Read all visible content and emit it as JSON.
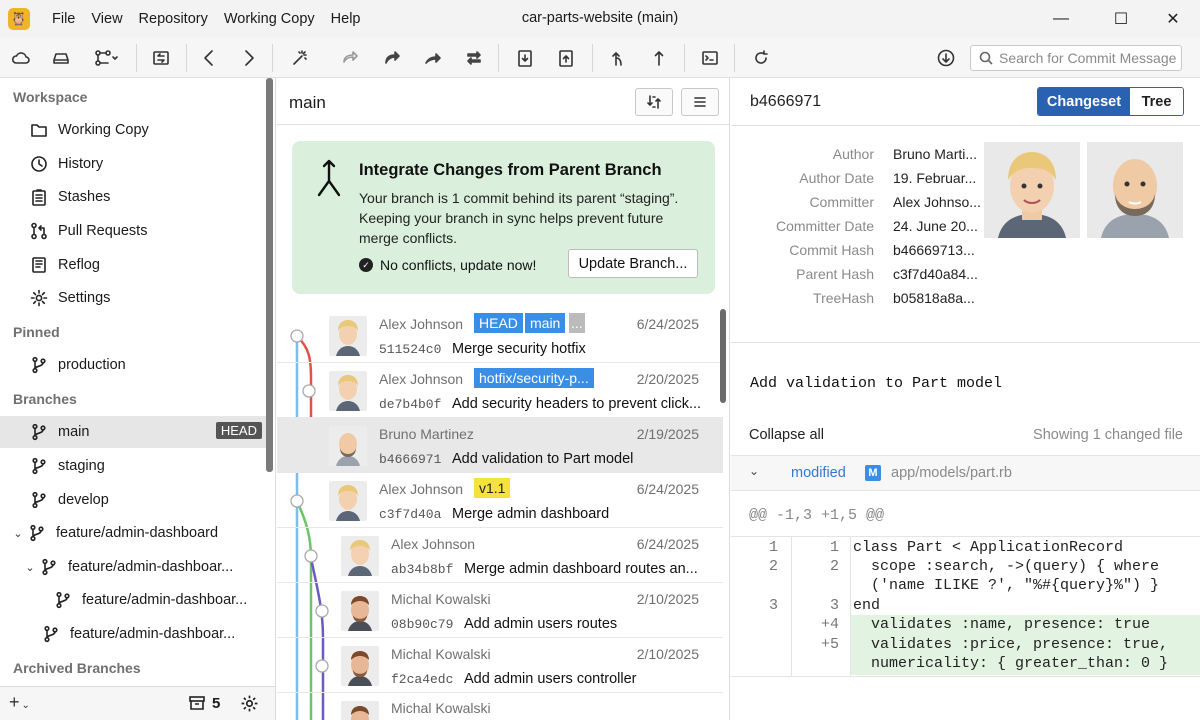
{
  "window": {
    "title": "car-parts-website (main)",
    "menu": [
      "File",
      "View",
      "Repository",
      "Working Copy",
      "Help"
    ]
  },
  "toolbar": {
    "search_placeholder": "Search for Commit Message"
  },
  "sidebar": {
    "workspace_title": "Workspace",
    "workspace_items": [
      {
        "label": "Working Copy",
        "icon": "folder-icon"
      },
      {
        "label": "History",
        "icon": "history-icon"
      },
      {
        "label": "Stashes",
        "icon": "clipboard-icon"
      },
      {
        "label": "Pull Requests",
        "icon": "pull-request-icon"
      },
      {
        "label": "Reflog",
        "icon": "book-icon"
      },
      {
        "label": "Settings",
        "icon": "gear-icon"
      }
    ],
    "pinned_title": "Pinned",
    "pinned_items": [
      {
        "label": "production"
      }
    ],
    "branches_title": "Branches",
    "branches": [
      {
        "label": "main",
        "badge": "HEAD",
        "selected": true
      },
      {
        "label": "staging"
      },
      {
        "label": "develop"
      },
      {
        "label": "feature/admin-dashboard"
      },
      {
        "label": "feature/admin-dashboar..."
      },
      {
        "label": "feature/admin-dashboar..."
      },
      {
        "label": "feature/admin-dashboar..."
      }
    ],
    "archived_title": "Archived Branches",
    "footer": {
      "stash_count": "5"
    }
  },
  "history": {
    "branch_title": "main",
    "integrate": {
      "title": "Integrate Changes from Parent Branch",
      "body": "Your branch is 1 commit behind its parent “staging”. Keeping your branch in sync helps prevent future merge conflicts.",
      "no_conflicts": "No conflicts, update now!",
      "button": "Update Branch..."
    },
    "commits": [
      {
        "author": "Alex Johnson",
        "date": "6/24/2025",
        "hash": "511524c0",
        "message": "Merge security hotfix",
        "tags": [
          "HEAD",
          "main",
          "..."
        ]
      },
      {
        "author": "Alex Johnson",
        "date": "2/20/2025",
        "hash": "de7b4b0f",
        "message": "Add security headers to prevent click...",
        "tags": [
          "hotfix/security-p..."
        ]
      },
      {
        "author": "Bruno Martinez",
        "date": "2/19/2025",
        "hash": "b4666971",
        "message": "Add validation to Part model",
        "tags": [],
        "selected": true
      },
      {
        "author": "Alex Johnson",
        "date": "6/24/2025",
        "hash": "c3f7d40a",
        "message": "Merge admin dashboard",
        "tags": [
          "v1.1"
        ]
      },
      {
        "author": "Alex Johnson",
        "date": "6/24/2025",
        "hash": "ab34b8bf",
        "message": "Merge admin dashboard routes an...",
        "tags": []
      },
      {
        "author": "Michal Kowalski",
        "date": "2/10/2025",
        "hash": "08b90c79",
        "message": "Add admin users routes",
        "tags": []
      },
      {
        "author": "Michal Kowalski",
        "date": "2/10/2025",
        "hash": "f2ca4edc",
        "message": "Add admin users controller",
        "tags": []
      },
      {
        "author": "Michal Kowalski",
        "date": "",
        "hash": "",
        "message": "",
        "tags": []
      }
    ]
  },
  "details": {
    "hash": "b4666971",
    "tabs": [
      "Changeset",
      "Tree"
    ],
    "meta": [
      {
        "key": "Author",
        "value": "Bruno Marti..."
      },
      {
        "key": "Author Date",
        "value": "19. Februar..."
      },
      {
        "key": "Committer",
        "value": "Alex Johnso..."
      },
      {
        "key": "Committer Date",
        "value": "24. June 20..."
      },
      {
        "key": "Commit Hash",
        "value": "b46669713..."
      },
      {
        "key": "Parent Hash",
        "value": "c3f7d40a84..."
      },
      {
        "key": "TreeHash",
        "value": "b05818a8a..."
      }
    ],
    "commit_message": "Add validation to Part model",
    "collapse_all": "Collapse all",
    "showing": "Showing 1 changed file",
    "file": {
      "status": "modified",
      "badge": "M",
      "path": "app/models/part.rb"
    },
    "hunk_header": "@@ -1,3 +1,5 @@",
    "diff_lines": [
      {
        "old": "1",
        "new": "1",
        "code": "class Part < ApplicationRecord"
      },
      {
        "old": "2",
        "new": "2",
        "code": "  scope :search, ->(query) { where"
      },
      {
        "old": "",
        "new": "",
        "code": "  ('name ILIKE ?', \"%#{query}%\") }"
      },
      {
        "old": "3",
        "new": "3",
        "code": "end"
      },
      {
        "old": "",
        "new": "+4",
        "code": "  validates :name, presence: true"
      },
      {
        "old": "",
        "new": "+5",
        "code": "  validates :price, presence: true,"
      },
      {
        "old": "",
        "new": "",
        "code": "  numericality: { greater_than: 0 }"
      }
    ]
  },
  "colors": {
    "accent": "#2a62b3",
    "tag_blue": "#3a8ee6",
    "tag_yellow": "#f5e23c",
    "banner_green": "#daf0dc",
    "graph_red": "#e0524a",
    "graph_green": "#6cc36c",
    "graph_blue": "#7dbde8",
    "graph_purple": "#6a5bc4"
  }
}
